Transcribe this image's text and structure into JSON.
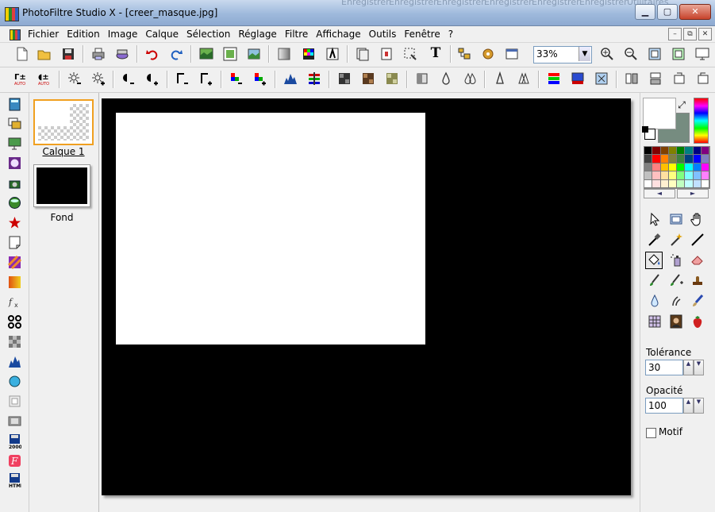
{
  "title_bar": {
    "title": "PhotoFiltre Studio X - [creer_masque.jpg]",
    "minimize": "▁",
    "maximize": "▢",
    "close": "✕"
  },
  "menu": {
    "items": [
      "Fichier",
      "Edition",
      "Image",
      "Calque",
      "Sélection",
      "Réglage",
      "Filtre",
      "Affichage",
      "Outils",
      "Fenêtre",
      "?"
    ],
    "mdi_minimize": "–",
    "mdi_restore": "⧉",
    "mdi_close": "✕"
  },
  "toolbar": {
    "zoom_value": "33%",
    "zoom_arrow": "▼",
    "text_tool_glyph": "T"
  },
  "layers": {
    "items": [
      {
        "name": "Calque 1",
        "selected": true
      },
      {
        "name": "Fond",
        "selected": false
      }
    ]
  },
  "colors": {
    "foreground": "#ffffff",
    "background": "#768c80",
    "swap_glyph": "⤢",
    "palette": [
      "#000000",
      "#800000",
      "#804000",
      "#808000",
      "#008000",
      "#008080",
      "#000080",
      "#800080",
      "#404040",
      "#ff0000",
      "#ff8000",
      "#808040",
      "#408040",
      "#004080",
      "#0000ff",
      "#8080c0",
      "#808080",
      "#ff8080",
      "#ffc000",
      "#ffff00",
      "#00ff00",
      "#00ffff",
      "#0080ff",
      "#ff00ff",
      "#c0c0c0",
      "#ffc0c0",
      "#ffe0a0",
      "#ffff80",
      "#80ff80",
      "#80ffff",
      "#80c0ff",
      "#ff80ff",
      "#ffffff",
      "#ffe0e0",
      "#fff0d0",
      "#ffffc0",
      "#c0ffc0",
      "#c0ffff",
      "#c0e0ff",
      "#ffffff"
    ],
    "palette_prev": "◄",
    "palette_next": "►"
  },
  "options": {
    "tolerance_label": "Tolérance",
    "tolerance_value": "30",
    "opacity_label": "Opacité",
    "opacity_value": "100",
    "motif_label": "Motif",
    "motif_checked": false,
    "spin_up": "▲",
    "spin_down": "▼"
  },
  "tabs_background": {
    "items": [
      "Enregistrer",
      "Enregistrer",
      "Enregistrer",
      "Enregistrer",
      "Enregistrer",
      "Enregistrer",
      "Utilitaires"
    ]
  }
}
